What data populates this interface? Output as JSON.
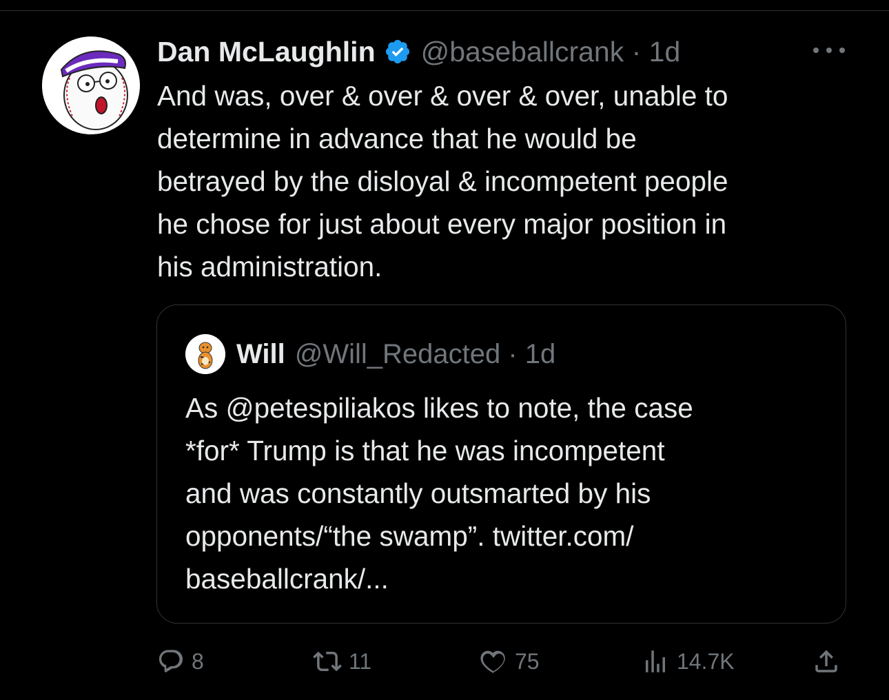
{
  "tweet": {
    "author_name": "Dan McLaughlin",
    "author_handle": "@baseballcrank · 1d",
    "text": "And was, over & over & over & over, unable to\ndetermine in advance that he would be\nbetrayed by the disloyal & incompetent people\nhe chose for just about every major position in\nhis administration."
  },
  "quoted": {
    "author_name": "Will",
    "author_handle": "@Will_Redacted · 1d",
    "text": "As @petespiliakos likes to note, the case\n*for* Trump is that he was incompetent\nand was constantly outsmarted by his\nopponents/“the swamp”. twitter.com/\nbaseballcrank/..."
  },
  "actions": {
    "replies": "8",
    "retweets": "11",
    "likes": "75",
    "views": "14.7K"
  },
  "icons": {
    "verified": "verified-badge-icon",
    "more": "more-dots-icon",
    "reply": "reply-icon",
    "retweet": "retweet-icon",
    "like": "heart-icon",
    "views": "views-chart-icon",
    "share": "share-icon"
  },
  "colors": {
    "background": "#000000",
    "text": "#e7e9ea",
    "muted": "#71767b",
    "verified": "#1d9bf0"
  }
}
